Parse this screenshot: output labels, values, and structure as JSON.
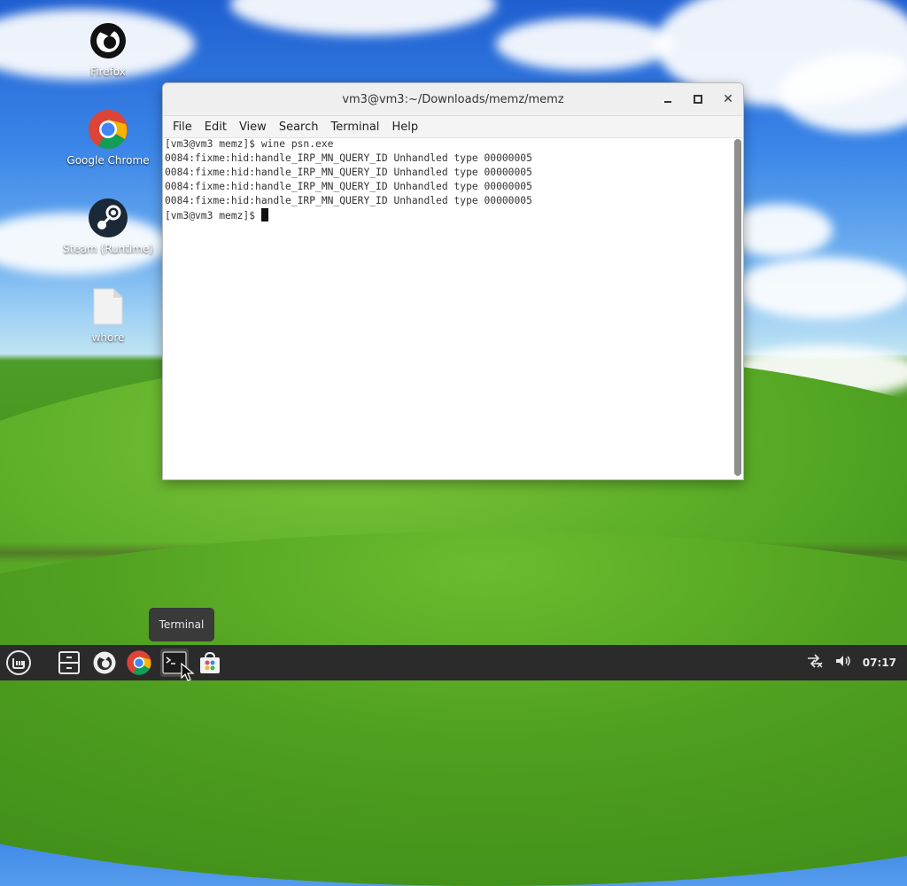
{
  "desktop": {
    "icons": [
      {
        "label": "Firefox",
        "icon": "firefox-icon"
      },
      {
        "label": "Google Chrome",
        "icon": "chrome-icon"
      },
      {
        "label": "Steam (Runtime)",
        "icon": "steam-icon"
      },
      {
        "label": "whore",
        "icon": "file-icon"
      }
    ]
  },
  "window": {
    "title": "vm3@vm3:~/Downloads/memz/memz",
    "menu": [
      "File",
      "Edit",
      "View",
      "Search",
      "Terminal",
      "Help"
    ],
    "terminal_lines": [
      "[vm3@vm3 memz]$ wine psn.exe",
      "0084:fixme:hid:handle_IRP_MN_QUERY_ID Unhandled type 00000005",
      "0084:fixme:hid:handle_IRP_MN_QUERY_ID Unhandled type 00000005",
      "0084:fixme:hid:handle_IRP_MN_QUERY_ID Unhandled type 00000005",
      "0084:fixme:hid:handle_IRP_MN_QUERY_ID Unhandled type 00000005"
    ],
    "prompt": "[vm3@vm3 memz]$ "
  },
  "taskbar": {
    "tooltip": "Terminal",
    "items": [
      "menu-icon",
      "file-manager-icon",
      "firefox-icon",
      "chrome-icon",
      "terminal-icon",
      "software-manager-icon"
    ],
    "clock": "07:17"
  }
}
